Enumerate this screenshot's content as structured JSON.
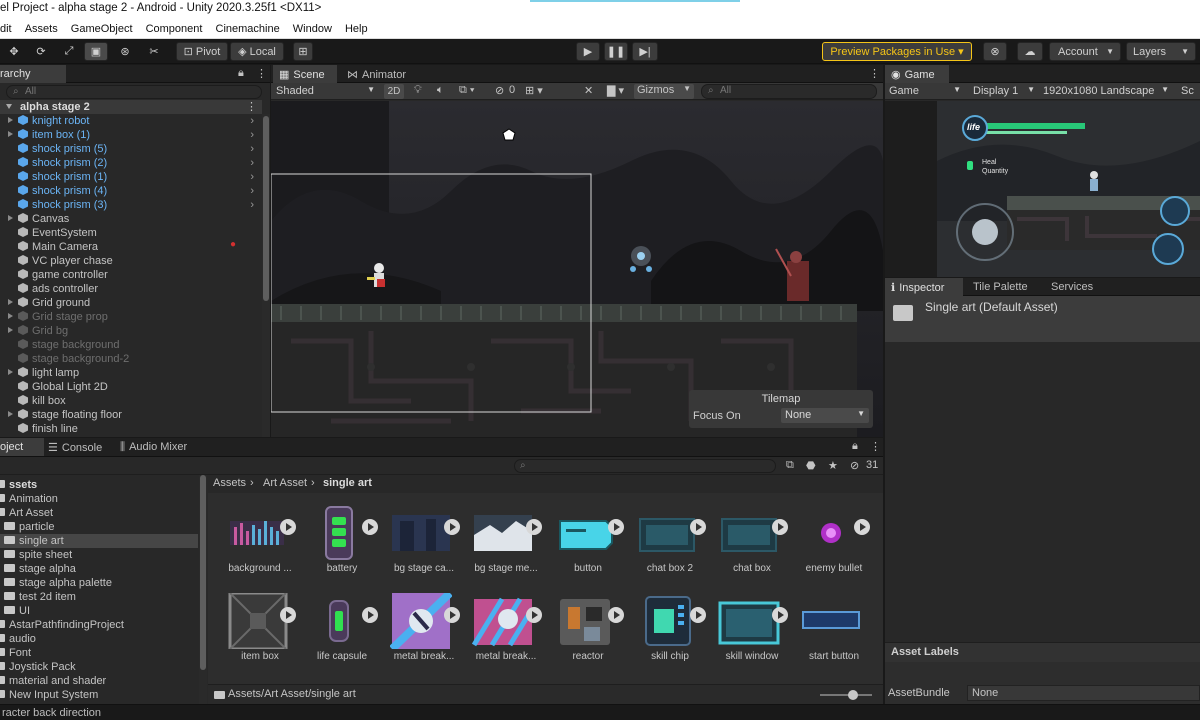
{
  "window": {
    "title": "el Project - alpha stage 2 - Android - Unity 2020.3.25f1 <DX11>"
  },
  "menu": [
    "dit",
    "Assets",
    "GameObject",
    "Component",
    "Cinemachine",
    "Window",
    "Help"
  ],
  "toolbar": {
    "pivot": "Pivot",
    "local": "Local",
    "preview_packages": "Preview Packages in Use ▾",
    "account": "Account",
    "layers": "Layers"
  },
  "hierarchy": {
    "tab": "rarchy",
    "search_placeholder": "All",
    "scene": "alpha stage 2",
    "items": [
      {
        "label": "knight robot",
        "prefab": true,
        "expand": true
      },
      {
        "label": "item box (1)",
        "prefab": true,
        "expand": true
      },
      {
        "label": "shock prism (5)",
        "prefab": true,
        "expand": false
      },
      {
        "label": "shock prism (2)",
        "prefab": true,
        "expand": false
      },
      {
        "label": "shock prism (1)",
        "prefab": true,
        "expand": false
      },
      {
        "label": "shock prism (4)",
        "prefab": true,
        "expand": false
      },
      {
        "label": "shock prism (3)",
        "prefab": true,
        "expand": false
      },
      {
        "label": "Canvas",
        "prefab": false,
        "expand": true
      },
      {
        "label": "EventSystem",
        "prefab": false,
        "expand": false
      },
      {
        "label": "Main Camera",
        "prefab": false,
        "expand": false
      },
      {
        "label": "VC player chase",
        "prefab": false,
        "expand": false
      },
      {
        "label": "game controller",
        "prefab": false,
        "expand": false
      },
      {
        "label": "ads controller",
        "prefab": false,
        "expand": false
      },
      {
        "label": "Grid ground",
        "prefab": false,
        "expand": true
      },
      {
        "label": "Grid stage prop",
        "prefab": false,
        "expand": true,
        "dim": true
      },
      {
        "label": "Grid bg",
        "prefab": false,
        "expand": true,
        "dim": true
      },
      {
        "label": "stage background",
        "prefab": false,
        "expand": false,
        "dim": true
      },
      {
        "label": "stage background-2",
        "prefab": false,
        "expand": false,
        "dim": true
      },
      {
        "label": "light lamp",
        "prefab": false,
        "expand": true
      },
      {
        "label": "Global Light 2D",
        "prefab": false,
        "expand": false
      },
      {
        "label": "kill box",
        "prefab": false,
        "expand": false
      },
      {
        "label": "stage floating floor",
        "prefab": false,
        "expand": true
      },
      {
        "label": "finish line",
        "prefab": false,
        "expand": false
      }
    ]
  },
  "scene": {
    "tab_scene": "Scene",
    "tab_animator": "Animator",
    "shading": "Shaded",
    "mode_2d": "2D",
    "hidden_count": "0",
    "gizmos": "Gizmos",
    "search_placeholder": "All",
    "tilemap_title": "Tilemap",
    "focus_label": "Focus On",
    "focus_value": "None"
  },
  "game": {
    "tab": "Game",
    "mode": "Game",
    "display": "Display 1",
    "resolution": "1920x1080 Landscape",
    "scale_cut": "Sc",
    "hud_life": "life",
    "hud_heal": "Heal",
    "hud_quantity": "Quantity"
  },
  "inspector": {
    "tab_inspector": "Inspector",
    "tab_tile_palette": "Tile Palette",
    "tab_services": "Services",
    "asset_title": "Single art (Default Asset)",
    "labels_header": "Asset Labels",
    "bundle_label": "AssetBundle",
    "bundle_value": "None"
  },
  "project": {
    "tab_project": "oject",
    "tab_console": "Console",
    "tab_audio_mixer": "Audio Mixer",
    "hidden_count": "31",
    "breadcrumb": [
      "Assets",
      "Art Asset",
      "single art"
    ],
    "footer_path": "Assets/Art Asset/single art",
    "tree": [
      {
        "label": "ssets",
        "indent": 0,
        "bold": true
      },
      {
        "label": "Animation",
        "indent": 0
      },
      {
        "label": "Art Asset",
        "indent": 0
      },
      {
        "label": "particle",
        "indent": 1
      },
      {
        "label": "single art",
        "indent": 1,
        "selected": true
      },
      {
        "label": "spite sheet",
        "indent": 1
      },
      {
        "label": "stage alpha",
        "indent": 1
      },
      {
        "label": "stage alpha palette",
        "indent": 1
      },
      {
        "label": "test 2d item",
        "indent": 1
      },
      {
        "label": "UI",
        "indent": 1
      },
      {
        "label": "AstarPathfindingProject",
        "indent": 0
      },
      {
        "label": "audio",
        "indent": 0
      },
      {
        "label": "Font",
        "indent": 0
      },
      {
        "label": "Joystick Pack",
        "indent": 0
      },
      {
        "label": "material and shader",
        "indent": 0
      },
      {
        "label": "New Input System",
        "indent": 0
      }
    ],
    "assets": [
      {
        "label": "background ..."
      },
      {
        "label": "battery"
      },
      {
        "label": "bg stage ca..."
      },
      {
        "label": "bg stage me..."
      },
      {
        "label": "button"
      },
      {
        "label": "chat box 2"
      },
      {
        "label": "chat box"
      },
      {
        "label": "enemy bullet"
      },
      {
        "label": "item box"
      },
      {
        "label": "life capsule"
      },
      {
        "label": "metal break..."
      },
      {
        "label": "metal break..."
      },
      {
        "label": "reactor"
      },
      {
        "label": "skill chip"
      },
      {
        "label": "skill window"
      },
      {
        "label": "start button"
      }
    ]
  },
  "status": {
    "text": "racter back direction"
  },
  "colors": {
    "accent": "#f5c518",
    "prefab": "#6bb4f5",
    "panel": "#282828",
    "selection": "#2c5d87"
  }
}
